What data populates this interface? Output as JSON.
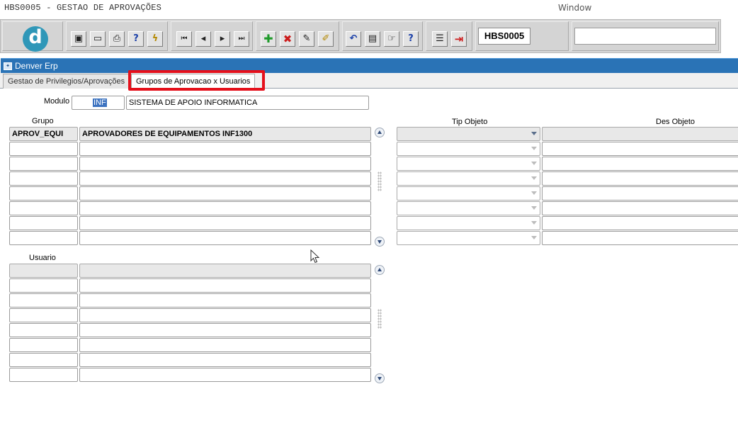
{
  "window": {
    "title": "HBS0005 - GESTAO DE APROVAÇÕES",
    "menu_window": "Window"
  },
  "toolbar": {
    "logo_letter": "d",
    "form_code": "HBS0005",
    "search_value": "",
    "buttons": [
      {
        "name": "save-icon",
        "glyph": "▣"
      },
      {
        "name": "screen-icon",
        "glyph": "▭"
      },
      {
        "name": "print-icon",
        "glyph": "⎙"
      },
      {
        "name": "query-help-icon",
        "glyph": "?"
      },
      {
        "name": "execute-query-icon",
        "glyph": "ϟ"
      },
      {
        "name": "first-record-icon",
        "glyph": "⏮"
      },
      {
        "name": "previous-record-icon",
        "glyph": "◂"
      },
      {
        "name": "next-record-icon",
        "glyph": "▸"
      },
      {
        "name": "last-record-icon",
        "glyph": "⏭"
      },
      {
        "name": "insert-record-icon",
        "glyph": "✚"
      },
      {
        "name": "delete-record-icon",
        "glyph": "✖"
      },
      {
        "name": "edit-record-icon",
        "glyph": "✎"
      },
      {
        "name": "clear-record-icon",
        "glyph": "✐"
      },
      {
        "name": "undo-icon",
        "glyph": "↶"
      },
      {
        "name": "clipboard-icon",
        "glyph": "▤"
      },
      {
        "name": "tools-icon",
        "glyph": "☞"
      },
      {
        "name": "help-icon",
        "glyph": "?"
      },
      {
        "name": "menu-icon",
        "glyph": "☰"
      },
      {
        "name": "exit-icon",
        "glyph": "⇥"
      }
    ]
  },
  "app": {
    "window_title": "Denver Erp",
    "window_icon": "window-icon"
  },
  "tabs": [
    {
      "label": "Gestao de Privilegios/Aprovações",
      "active": false
    },
    {
      "label": "Grupos de Aprovacao x Usuarios",
      "active": true
    }
  ],
  "form": {
    "modulo_label": "Modulo",
    "modulo_code": "INF",
    "modulo_desc": "SISTEMA DE APOIO INFORMATICA",
    "grupo_header": "Grupo",
    "grupo_rows": [
      {
        "code": "APROV_EQUI",
        "desc": "APROVADORES DE EQUIPAMENTOS INF1300"
      },
      {
        "code": "",
        "desc": ""
      },
      {
        "code": "",
        "desc": ""
      },
      {
        "code": "",
        "desc": ""
      },
      {
        "code": "",
        "desc": ""
      },
      {
        "code": "",
        "desc": ""
      },
      {
        "code": "",
        "desc": ""
      },
      {
        "code": "",
        "desc": ""
      }
    ],
    "tip_objeto_header": "Tip Objeto",
    "des_objeto_header": "Des Objeto",
    "usuario_header": "Usuario",
    "usuario_rows": [
      {
        "code": "",
        "desc": ""
      },
      {
        "code": "",
        "desc": ""
      },
      {
        "code": "",
        "desc": ""
      },
      {
        "code": "",
        "desc": ""
      },
      {
        "code": "",
        "desc": ""
      },
      {
        "code": "",
        "desc": ""
      },
      {
        "code": "",
        "desc": ""
      },
      {
        "code": "",
        "desc": ""
      }
    ]
  },
  "colors": {
    "window_bar": "#2a73b6",
    "highlight": "#e5101b",
    "logo": "#2f97b8"
  }
}
